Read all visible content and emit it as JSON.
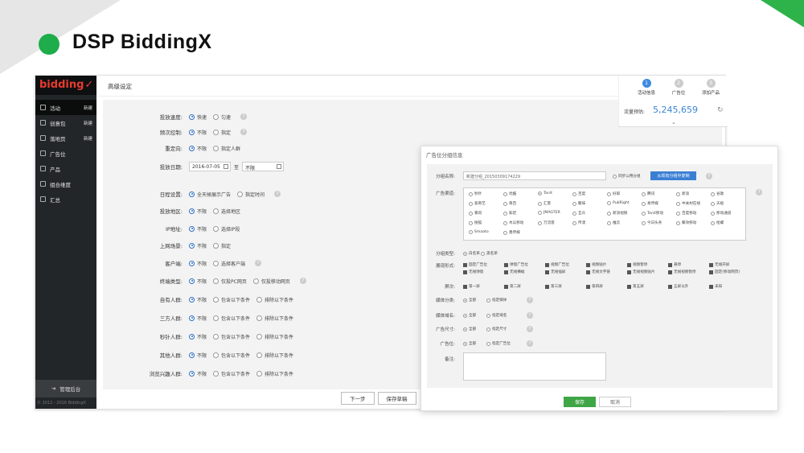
{
  "slide": {
    "title": "DSP BiddingX",
    "accent": "#1fac4b"
  },
  "app": {
    "logo": "bidding",
    "page_title": "高级设定",
    "copyright": "© 2012 - 2016 BiddingX",
    "admin_label": "管理后台",
    "nav": [
      {
        "label": "活动",
        "badge": "新建",
        "icon": "activity-icon"
      },
      {
        "label": "创意包",
        "badge": "新建",
        "icon": "creative-icon"
      },
      {
        "label": "落地页",
        "badge": "新建",
        "icon": "landing-icon"
      },
      {
        "label": "广告位",
        "badge": "",
        "icon": "adslot-icon"
      },
      {
        "label": "产品",
        "badge": "",
        "icon": "product-icon"
      },
      {
        "label": "组合维度",
        "badge": "",
        "icon": "dimension-icon"
      },
      {
        "label": "汇总",
        "badge": "",
        "icon": "summary-icon"
      }
    ],
    "steps": [
      {
        "num": "1",
        "label": "活动信息"
      },
      {
        "num": "2",
        "label": "广告位"
      },
      {
        "num": "3",
        "label": "添加产品"
      }
    ],
    "flow_label": "流量预估:",
    "flow_value": "5,245,659",
    "form": [
      {
        "label": "投放速度:",
        "options": [
          "快速",
          "匀速"
        ],
        "help": true
      },
      {
        "label": "频次控制:",
        "options": [
          "不限",
          "指定"
        ],
        "help": true
      },
      {
        "label": "重定向:",
        "options": [
          "不限",
          "指定人群"
        ],
        "help": false
      },
      {
        "label": "日程设置:",
        "options": [
          "全天候展示广告",
          "指定时间"
        ],
        "help": true
      },
      {
        "label": "投放地区:",
        "options": [
          "不限",
          "选择地区"
        ],
        "help": false
      },
      {
        "label": "IP地址:",
        "options": [
          "不限",
          "选择IP段"
        ],
        "help": false
      },
      {
        "label": "上网场景:",
        "options": [
          "不限",
          "指定"
        ],
        "help": false
      },
      {
        "label": "客户端:",
        "options": [
          "不限",
          "选择客户端"
        ],
        "help": true
      },
      {
        "label": "终端类型:",
        "options": [
          "不限",
          "仅投PC网页",
          "仅投移动网页"
        ],
        "help": true
      },
      {
        "label": "自有人群:",
        "options": [
          "不限",
          "包含以下条件",
          "排除以下条件"
        ],
        "help": false
      },
      {
        "label": "三方人群:",
        "options": [
          "不限",
          "包含以下条件",
          "排除以下条件"
        ],
        "help": false
      },
      {
        "label": "秒针人群:",
        "options": [
          "不限",
          "包含以下条件",
          "排除以下条件"
        ],
        "help": false
      },
      {
        "label": "其他人群:",
        "options": [
          "不限",
          "包含以下条件",
          "排除以下条件"
        ],
        "help": false
      },
      {
        "label": "浏览兴趣人群:",
        "options": [
          "不限",
          "包含以下条件",
          "排除以下条件"
        ],
        "help": false
      }
    ],
    "date": {
      "label": "投放日期:",
      "start": "2016-07-05",
      "sep": "至",
      "end": "不限"
    },
    "buttons": {
      "next": "下一步",
      "save_draft": "保存草稿"
    }
  },
  "overlay": {
    "title": "广告位分组信息",
    "group_name_label": "分组名称:",
    "group_name_value": "新建分组_20150309174229",
    "sync_label": "同步公用分组",
    "sync_button": "从现有分组中复制",
    "channel_label": "广告渠道:",
    "channels": [
      "秒针",
      "优酷",
      "TanX",
      "百度",
      "好耶",
      "腾讯",
      "新浪",
      "谷歌",
      "爱奇艺",
      "奇百",
      "汇客",
      "聚味",
      "PubRight",
      "易传媒",
      "中关村在线",
      "天极",
      "暴风",
      "知足",
      "JMAGTER",
      "互众",
      "新浪视频",
      "TanX移动",
      "百度移动",
      "移动通道",
      "搜狐",
      "木瓜移动",
      "万流客",
      "传漾",
      "推云",
      "今日头条",
      "聚效移动",
      "给螺",
      "Smaato",
      "墨传媒"
    ],
    "group_type_label": "分组类型:",
    "group_types": [
      "白名单",
      "黑名单"
    ],
    "format_label": "展现形式:",
    "formats": [
      "固定广告位",
      "弹窗广告位",
      "视频广告位",
      "视频贴片",
      "视频暂停",
      "悬停",
      "无线开屏",
      "无线弹窗",
      "无线横幅",
      "无线插屏",
      "无线文字链",
      "无线视频贴片",
      "无线视频暂停",
      "固定(移动网页)"
    ],
    "screen_label": "屏次:",
    "screens": [
      "第一屏",
      "第二屏",
      "第三屏",
      "第四屏",
      "第五屏",
      "五屏以外",
      "未知"
    ],
    "media_cat_label": "媒体分类:",
    "media_domain_label": "媒体域名:",
    "size_label": "广告尺寸:",
    "slot_label": "广告位:",
    "all": "全部",
    "specify_media": "指定媒体",
    "specify_domain": "指定域名",
    "specify_size": "指定尺寸",
    "specify_slot": "指定广告位",
    "note_label": "备注:",
    "save": "保存",
    "cancel": "取消"
  }
}
